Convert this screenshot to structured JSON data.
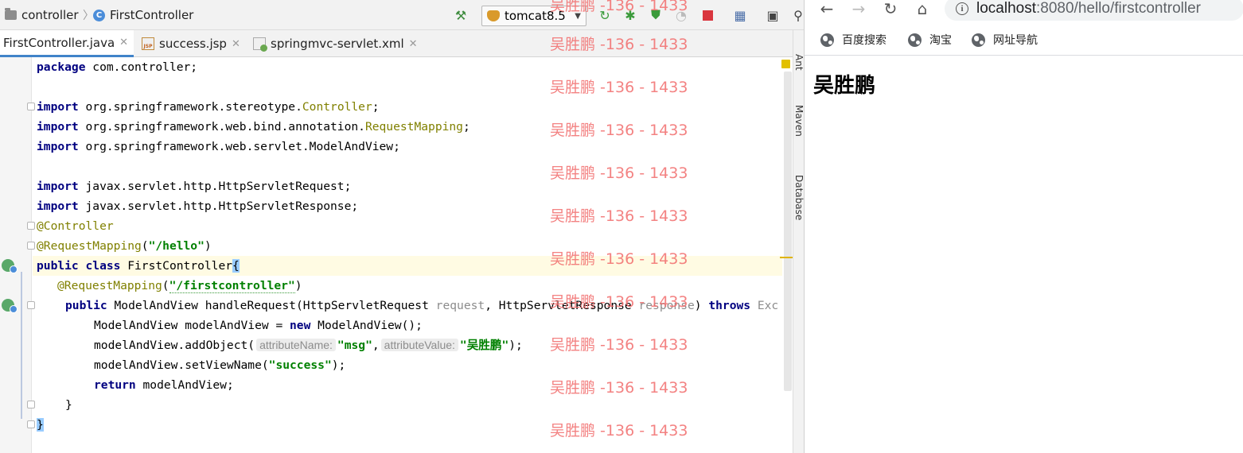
{
  "ide": {
    "breadcrumbs": [
      "controller",
      "FirstController"
    ],
    "run_config": "tomcat8.5",
    "tabs": [
      {
        "label": "FirstController.java",
        "active": true
      },
      {
        "label": "success.jsp",
        "active": false
      },
      {
        "label": "springmvc-servlet.xml",
        "active": false
      }
    ],
    "side_tools": [
      "Ant",
      "Maven",
      "Database"
    ],
    "code": {
      "package": [
        "package",
        " com.controller;"
      ],
      "import1": [
        "import",
        " org.springframework.stereotype.",
        "Controller",
        ";"
      ],
      "import2": [
        "import",
        " org.springframework.web.bind.annotation.",
        "RequestMapping",
        ";"
      ],
      "import3": [
        "import",
        " org.springframework.web.servlet.ModelAndView;"
      ],
      "import4": [
        "import",
        " javax.servlet.http.HttpServletRequest;"
      ],
      "import5": [
        "import",
        " javax.servlet.http.HttpServletResponse;"
      ],
      "ann_controller": "@Controller",
      "ann_mapping1": [
        "@RequestMapping",
        "(",
        "\"/hello\"",
        ")"
      ],
      "class_decl": [
        "public",
        " ",
        "class",
        " FirstController",
        "{"
      ],
      "ann_mapping2": [
        "@RequestMapping",
        "(",
        "\"/firstcontroller\"",
        ")"
      ],
      "method": [
        "public",
        " ModelAndView handleRequest(HttpServletRequest ",
        "request",
        ", HttpServletResponse ",
        "response",
        ") ",
        "throws",
        " Exc"
      ],
      "line_new": [
        "ModelAndView modelAndView = ",
        "new",
        " ModelAndView();"
      ],
      "line_add": [
        "modelAndView.addObject(",
        "attributeName:",
        "\"msg\"",
        ",",
        "attributeValue:",
        "\"吴胜鹏\"",
        ");"
      ],
      "line_view": [
        "modelAndView.setViewName(",
        "\"success\"",
        ");"
      ],
      "line_return": [
        "return",
        " modelAndView;"
      ],
      "close_method": "}",
      "close_class": "}"
    }
  },
  "browser": {
    "url_host": "localhost",
    "url_rest": ":8080/hello/firstcontroller",
    "bookmarks": [
      "百度搜索",
      "淘宝",
      "网址导航"
    ],
    "page_heading": "吴胜鹏"
  },
  "watermark": "吴胜鹏 -136 - 1433",
  "colors": {
    "keyword": "#000080",
    "annotation": "#808000",
    "string": "#008000",
    "watermark": "#f26d6d"
  }
}
